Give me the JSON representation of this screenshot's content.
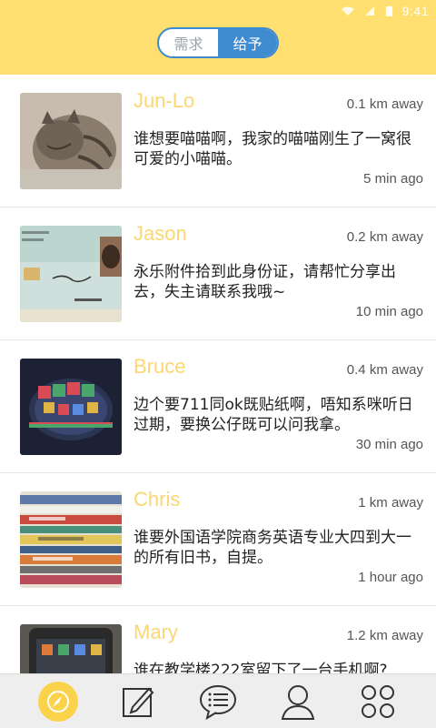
{
  "status_bar": {
    "time": "9:41"
  },
  "tabs": [
    {
      "label": "需求",
      "active": false
    },
    {
      "label": "给予",
      "active": true
    }
  ],
  "posts": [
    {
      "name": "Jun-Lo",
      "distance": "0.1 km away",
      "text": "谁想要喵喵啊，我家的喵喵刚生了一窝很可爱的小喵喵。",
      "time": "5 min ago",
      "thumb": "cat-photo"
    },
    {
      "name": "Jason",
      "distance": "0.2 km away",
      "text": "永乐附件拾到此身份证，请帮忙分享出去，失主请联系我哦~",
      "time": "10 min ago",
      "thumb": "id-card-photo"
    },
    {
      "name": "Bruce",
      "distance": "0.4 km away",
      "text": "边个要711同ok既贴纸啊，唔知系咪听日过期，要换公仔既可以问我拿。",
      "time": "30 min ago",
      "thumb": "stickers-photo"
    },
    {
      "name": "Chris",
      "distance": "1 km away",
      "text": "谁要外国语学院商务英语专业大四到大一的所有旧书，自提。",
      "time": "1 hour ago",
      "thumb": "books-photo"
    },
    {
      "name": "Mary",
      "distance": "1.2 km away",
      "text": "谁在教学楼222室留下了一台手机啊?",
      "time": "",
      "thumb": "phone-photo"
    }
  ],
  "nav": [
    {
      "icon": "compass-icon",
      "active": true
    },
    {
      "icon": "edit-icon",
      "active": false
    },
    {
      "icon": "chat-icon",
      "active": false
    },
    {
      "icon": "profile-icon",
      "active": false
    },
    {
      "icon": "grid-icon",
      "active": false
    }
  ],
  "colors": {
    "header": "#fedf70",
    "accent": "#3f8bd0",
    "name": "#fad772"
  }
}
